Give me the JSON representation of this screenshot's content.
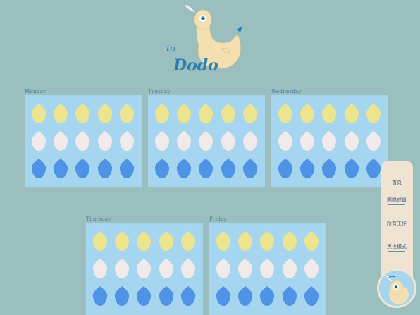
{
  "logo": {
    "text_top": "to",
    "text_bottom": "Dodo"
  },
  "days": [
    {
      "label": "Monday"
    },
    {
      "label": "Tuesday"
    },
    {
      "label": "Wednesday"
    },
    {
      "label": "Thursday"
    },
    {
      "label": "Friday"
    }
  ],
  "egg_rows": [
    {
      "color": "#ece48e"
    },
    {
      "color": "#f1eaea"
    },
    {
      "color": "#4f93e6"
    }
  ],
  "eggs_per_row": 5,
  "sidebar": {
    "items": [
      {
        "label": "首頁"
      },
      {
        "label": "團隊成員"
      },
      {
        "label": "所有工作"
      },
      {
        "label": "黑夜模式"
      }
    ]
  },
  "colors": {
    "background": "#9bbfbe",
    "card": "#a5d5ef",
    "sidebar": "#efe4d2",
    "label": "#4a77a0"
  }
}
